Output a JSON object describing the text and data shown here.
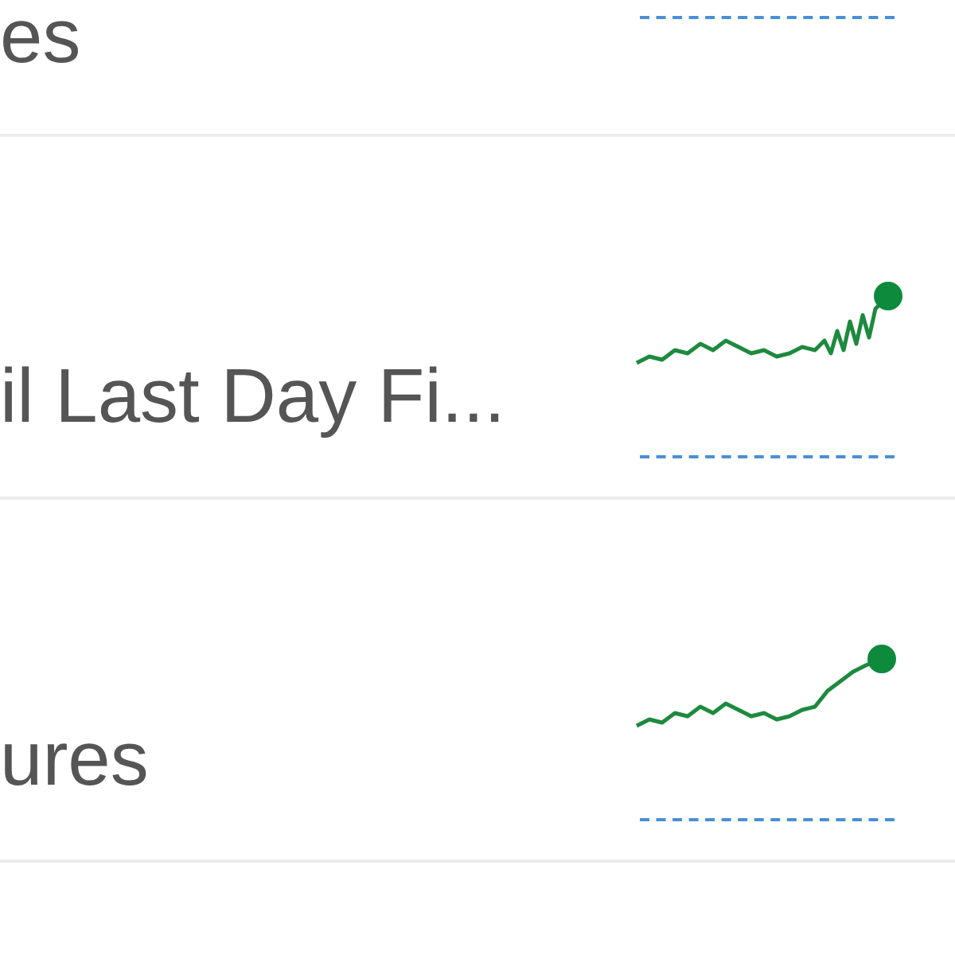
{
  "rows": [
    {
      "name": "es"
    },
    {
      "name": "il Last Day Fi..."
    },
    {
      "name": "ures"
    }
  ]
}
